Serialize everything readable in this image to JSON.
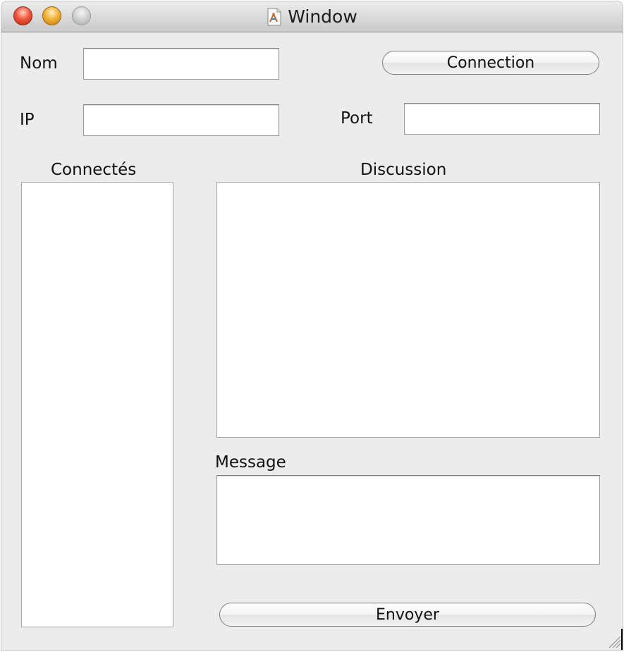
{
  "window": {
    "title": "Window",
    "app_icon": "java-app-icon"
  },
  "form": {
    "nom_label": "Nom",
    "nom_value": "",
    "ip_label": "IP",
    "ip_value": "",
    "port_label": "Port",
    "port_value": "",
    "connect_button": "Connection"
  },
  "panels": {
    "connected_label": "Connectés",
    "discussion_label": "Discussion",
    "message_label": "Message",
    "message_value": ""
  },
  "actions": {
    "send_button": "Envoyer"
  },
  "colors": {
    "window_bg": "#ececec",
    "close_button": "#e0442a",
    "minimize_button": "#e8a32a",
    "zoom_button_disabled": "#c4c4c4"
  }
}
